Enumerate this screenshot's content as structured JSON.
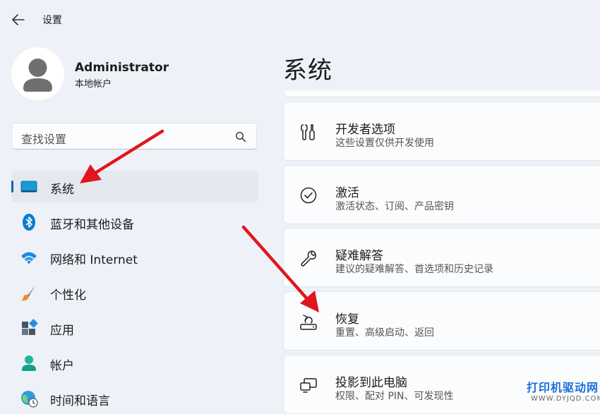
{
  "window": {
    "title": "设置"
  },
  "user": {
    "name": "Administrator",
    "account_type": "本地帐户"
  },
  "search": {
    "placeholder": "查找设置"
  },
  "nav": {
    "items": [
      {
        "label": "系统",
        "icon": "system-display-icon",
        "active": true
      },
      {
        "label": "蓝牙和其他设备",
        "icon": "bluetooth-icon"
      },
      {
        "label": "网络和 Internet",
        "icon": "wifi-icon"
      },
      {
        "label": "个性化",
        "icon": "paintbrush-icon"
      },
      {
        "label": "应用",
        "icon": "apps-icon"
      },
      {
        "label": "帐户",
        "icon": "account-icon"
      },
      {
        "label": "时间和语言",
        "icon": "globe-clock-icon"
      }
    ]
  },
  "main": {
    "title": "系统",
    "cards": [
      {
        "title": "开发者选项",
        "subtitle": "这些设置仅供开发使用",
        "icon": "developer-tools-icon"
      },
      {
        "title": "激活",
        "subtitle": "激活状态、订阅、产品密钥",
        "icon": "check-circle-icon"
      },
      {
        "title": "疑难解答",
        "subtitle": "建议的疑难解答、首选项和历史记录",
        "icon": "wrench-icon"
      },
      {
        "title": "恢复",
        "subtitle": "重置、高级启动、返回",
        "icon": "recovery-icon"
      },
      {
        "title": "投影到此电脑",
        "subtitle": "权限、配对 PIN、可发现性",
        "icon": "project-to-pc-icon"
      }
    ]
  },
  "watermark": {
    "title": "打印机驱动网",
    "url": "WWW.DYJQD.COM"
  },
  "colors": {
    "accent": "#0067c0",
    "annotation_arrow": "#e0161c",
    "watermark": "#1d6fd8"
  }
}
